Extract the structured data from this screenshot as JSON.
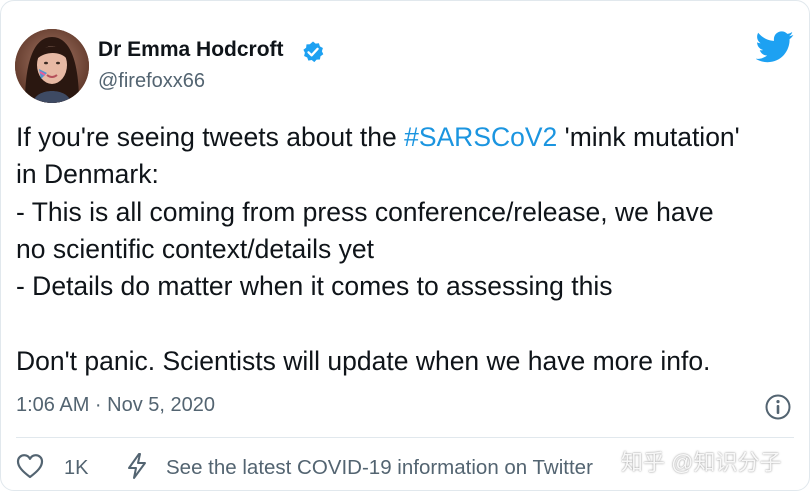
{
  "author": {
    "display_name": "Dr Emma Hodcroft",
    "handle": "@firefoxx66",
    "verified": true
  },
  "tweet": {
    "lines": [
      {
        "before": "If you're seeing tweets about the ",
        "hashtag": "#SARSCoV2",
        "after": " 'mink mutation'"
      },
      {
        "text": "in Denmark:"
      },
      {
        "text": "- This is all coming from press conference/release, we have"
      },
      {
        "text": "no scientific context/details yet"
      },
      {
        "text": "- Details do matter when it comes to assessing this"
      },
      {
        "text": ""
      },
      {
        "text": "Don't panic. Scientists will update when we have more info."
      }
    ],
    "timestamp": "1:06 AM · Nov 5, 2020"
  },
  "actions": {
    "like_count": "1K",
    "covid_info_label": "See the latest COVID-19 information on Twitter"
  },
  "watermark": "知乎 @知识分子",
  "colors": {
    "brand_blue": "#1da1f2",
    "hashtag": "#1b95e0",
    "text_primary": "#0f1419",
    "text_secondary": "#536471",
    "border": "#e1e8ed"
  },
  "icons": {
    "verified": "verified-badge-icon",
    "brand": "twitter-bird-icon",
    "info": "info-icon",
    "like": "heart-icon",
    "covid": "lightning-icon"
  }
}
